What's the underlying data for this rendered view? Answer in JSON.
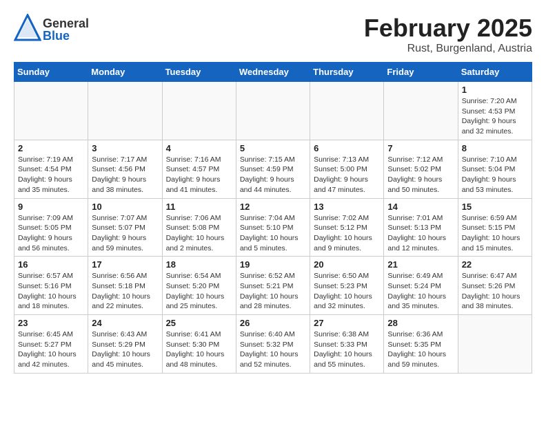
{
  "header": {
    "logo_general": "General",
    "logo_blue": "Blue",
    "month": "February 2025",
    "location": "Rust, Burgenland, Austria"
  },
  "days_of_week": [
    "Sunday",
    "Monday",
    "Tuesday",
    "Wednesday",
    "Thursday",
    "Friday",
    "Saturday"
  ],
  "weeks": [
    [
      {
        "day": "",
        "info": ""
      },
      {
        "day": "",
        "info": ""
      },
      {
        "day": "",
        "info": ""
      },
      {
        "day": "",
        "info": ""
      },
      {
        "day": "",
        "info": ""
      },
      {
        "day": "",
        "info": ""
      },
      {
        "day": "1",
        "info": "Sunrise: 7:20 AM\nSunset: 4:53 PM\nDaylight: 9 hours\nand 32 minutes."
      }
    ],
    [
      {
        "day": "2",
        "info": "Sunrise: 7:19 AM\nSunset: 4:54 PM\nDaylight: 9 hours\nand 35 minutes."
      },
      {
        "day": "3",
        "info": "Sunrise: 7:17 AM\nSunset: 4:56 PM\nDaylight: 9 hours\nand 38 minutes."
      },
      {
        "day": "4",
        "info": "Sunrise: 7:16 AM\nSunset: 4:57 PM\nDaylight: 9 hours\nand 41 minutes."
      },
      {
        "day": "5",
        "info": "Sunrise: 7:15 AM\nSunset: 4:59 PM\nDaylight: 9 hours\nand 44 minutes."
      },
      {
        "day": "6",
        "info": "Sunrise: 7:13 AM\nSunset: 5:00 PM\nDaylight: 9 hours\nand 47 minutes."
      },
      {
        "day": "7",
        "info": "Sunrise: 7:12 AM\nSunset: 5:02 PM\nDaylight: 9 hours\nand 50 minutes."
      },
      {
        "day": "8",
        "info": "Sunrise: 7:10 AM\nSunset: 5:04 PM\nDaylight: 9 hours\nand 53 minutes."
      }
    ],
    [
      {
        "day": "9",
        "info": "Sunrise: 7:09 AM\nSunset: 5:05 PM\nDaylight: 9 hours\nand 56 minutes."
      },
      {
        "day": "10",
        "info": "Sunrise: 7:07 AM\nSunset: 5:07 PM\nDaylight: 9 hours\nand 59 minutes."
      },
      {
        "day": "11",
        "info": "Sunrise: 7:06 AM\nSunset: 5:08 PM\nDaylight: 10 hours\nand 2 minutes."
      },
      {
        "day": "12",
        "info": "Sunrise: 7:04 AM\nSunset: 5:10 PM\nDaylight: 10 hours\nand 5 minutes."
      },
      {
        "day": "13",
        "info": "Sunrise: 7:02 AM\nSunset: 5:12 PM\nDaylight: 10 hours\nand 9 minutes."
      },
      {
        "day": "14",
        "info": "Sunrise: 7:01 AM\nSunset: 5:13 PM\nDaylight: 10 hours\nand 12 minutes."
      },
      {
        "day": "15",
        "info": "Sunrise: 6:59 AM\nSunset: 5:15 PM\nDaylight: 10 hours\nand 15 minutes."
      }
    ],
    [
      {
        "day": "16",
        "info": "Sunrise: 6:57 AM\nSunset: 5:16 PM\nDaylight: 10 hours\nand 18 minutes."
      },
      {
        "day": "17",
        "info": "Sunrise: 6:56 AM\nSunset: 5:18 PM\nDaylight: 10 hours\nand 22 minutes."
      },
      {
        "day": "18",
        "info": "Sunrise: 6:54 AM\nSunset: 5:20 PM\nDaylight: 10 hours\nand 25 minutes."
      },
      {
        "day": "19",
        "info": "Sunrise: 6:52 AM\nSunset: 5:21 PM\nDaylight: 10 hours\nand 28 minutes."
      },
      {
        "day": "20",
        "info": "Sunrise: 6:50 AM\nSunset: 5:23 PM\nDaylight: 10 hours\nand 32 minutes."
      },
      {
        "day": "21",
        "info": "Sunrise: 6:49 AM\nSunset: 5:24 PM\nDaylight: 10 hours\nand 35 minutes."
      },
      {
        "day": "22",
        "info": "Sunrise: 6:47 AM\nSunset: 5:26 PM\nDaylight: 10 hours\nand 38 minutes."
      }
    ],
    [
      {
        "day": "23",
        "info": "Sunrise: 6:45 AM\nSunset: 5:27 PM\nDaylight: 10 hours\nand 42 minutes."
      },
      {
        "day": "24",
        "info": "Sunrise: 6:43 AM\nSunset: 5:29 PM\nDaylight: 10 hours\nand 45 minutes."
      },
      {
        "day": "25",
        "info": "Sunrise: 6:41 AM\nSunset: 5:30 PM\nDaylight: 10 hours\nand 48 minutes."
      },
      {
        "day": "26",
        "info": "Sunrise: 6:40 AM\nSunset: 5:32 PM\nDaylight: 10 hours\nand 52 minutes."
      },
      {
        "day": "27",
        "info": "Sunrise: 6:38 AM\nSunset: 5:33 PM\nDaylight: 10 hours\nand 55 minutes."
      },
      {
        "day": "28",
        "info": "Sunrise: 6:36 AM\nSunset: 5:35 PM\nDaylight: 10 hours\nand 59 minutes."
      },
      {
        "day": "",
        "info": ""
      }
    ]
  ]
}
